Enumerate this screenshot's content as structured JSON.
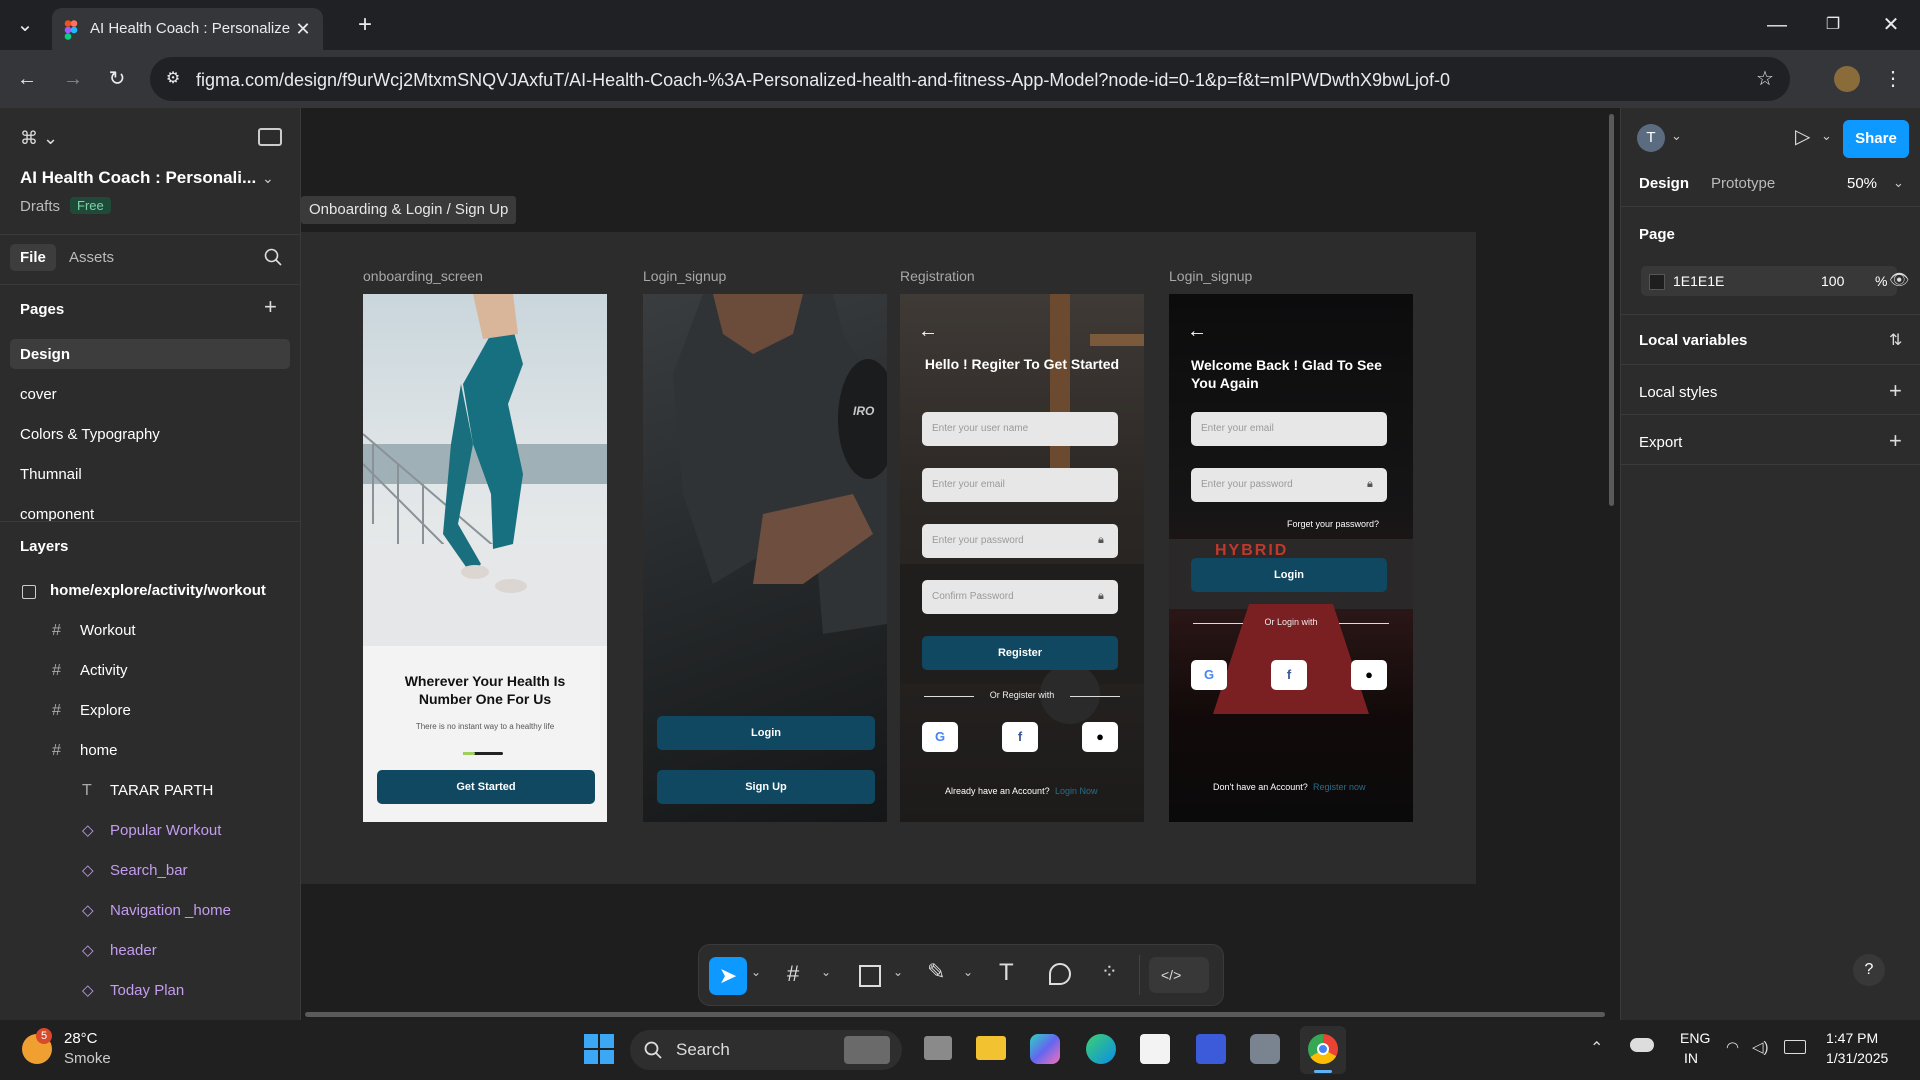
{
  "browser": {
    "tab_title": "AI Health Coach : Personalized h",
    "url": "figma.com/design/f9urWcj2MtxmSNQVJAxfuT/AI-Health-Coach-%3A-Personalized-health-and-fitness-App-Model?node-id=0-1&p=f&t=mIPWDwthX9bwLjof-0"
  },
  "figma": {
    "file_title": "AI Health Coach : Personali...",
    "drafts_label": "Drafts",
    "plan_badge": "Free",
    "tabs": {
      "file": "File",
      "assets": "Assets"
    },
    "pages_heading": "Pages",
    "pages": [
      "Design",
      "cover",
      "Colors & Typography",
      "Thumnail",
      "component"
    ],
    "layers_heading": "Layers",
    "layers": [
      {
        "name": "home/explore/activity/workout",
        "type": "section"
      },
      {
        "name": "Workout",
        "type": "frame"
      },
      {
        "name": "Activity",
        "type": "frame"
      },
      {
        "name": "Explore",
        "type": "frame"
      },
      {
        "name": "home",
        "type": "frame"
      },
      {
        "name": "TARAR PARTH",
        "type": "text"
      },
      {
        "name": "Popular Workout",
        "type": "component"
      },
      {
        "name": "Search_bar",
        "type": "component"
      },
      {
        "name": "Navigation _home",
        "type": "component"
      },
      {
        "name": "header",
        "type": "component"
      },
      {
        "name": "Today Plan",
        "type": "component"
      }
    ],
    "right": {
      "avatar_letter": "T",
      "share": "Share",
      "tab_design": "Design",
      "tab_prototype": "Prototype",
      "zoom": "50%",
      "page_heading": "Page",
      "page_color": "1E1E1E",
      "page_opacity": "100",
      "percent": "%",
      "local_variables": "Local variables",
      "local_styles": "Local styles",
      "export": "Export"
    }
  },
  "canvas": {
    "section_tag": "Onboarding & Login / Sign Up",
    "frames": [
      "onboarding_screen",
      "Login_signup",
      "Registration",
      "Login_signup"
    ],
    "onboarding": {
      "headline": "Wherever Your Health Is Number One For Us",
      "subtext": "There is no instant way to a healthy life",
      "cta": "Get Started"
    },
    "login_signup": {
      "login": "Login",
      "signup": "Sign Up",
      "brand_text": "IRO"
    },
    "registration": {
      "title": "Hello ! Regiter To Get Started",
      "fields": [
        "Enter your user name",
        "Enter your email",
        "Enter your password",
        "Confirm Password"
      ],
      "button": "Register",
      "divider": "Or Register with",
      "footer": "Already have an Account?",
      "footer_link": "Login Now"
    },
    "login": {
      "title": "Welcome Back ! Glad To See You Again",
      "fields": [
        "Enter your email",
        "Enter your password"
      ],
      "forgot": "Forget your password?",
      "button": "Login",
      "divider": "Or Login with",
      "footer": "Don't have an Account?",
      "footer_link": "Register now",
      "gym_sign": "HYBRID"
    }
  },
  "taskbar": {
    "weather_temp": "28°C",
    "weather_desc": "Smoke",
    "weather_badge": "5",
    "search": "Search",
    "lang": "ENG",
    "region": "IN",
    "time": "1:47 PM",
    "date": "1/31/2025"
  },
  "colors": {
    "figma_blue": "#0d99ff",
    "accent_teal": "#0f4860",
    "component_purple": "#c49cf0"
  }
}
